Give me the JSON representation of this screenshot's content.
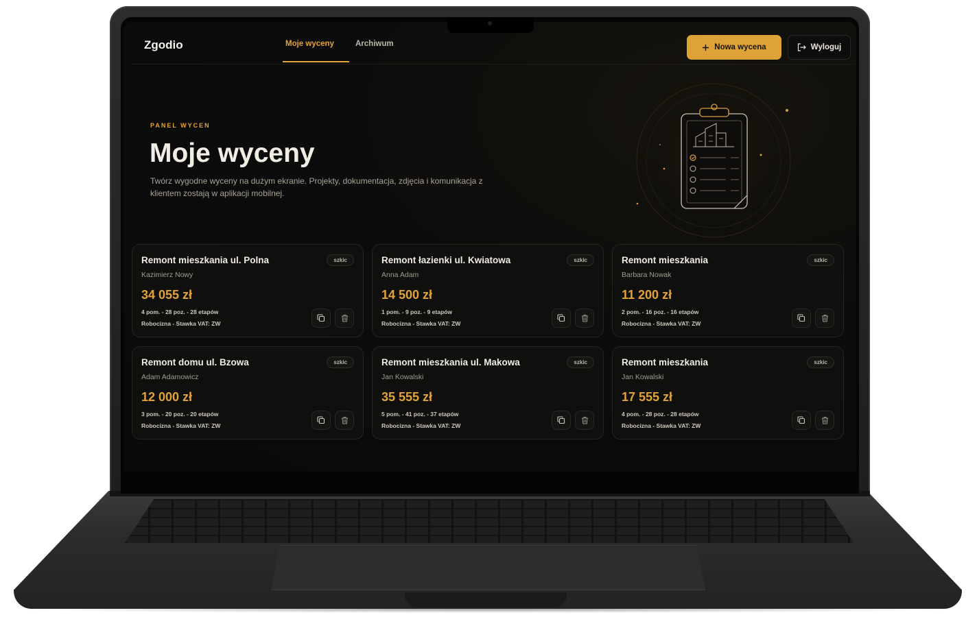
{
  "app": {
    "brand": "Zgodio"
  },
  "nav": {
    "tabs": [
      {
        "label": "Moje wyceny",
        "active": true
      },
      {
        "label": "Archiwum",
        "active": false
      }
    ],
    "new_quote_label": "Nowa wycena",
    "logout_label": "Wyloguj"
  },
  "hero": {
    "eyebrow": "PANEL WYCEN",
    "title": "Moje wyceny",
    "description": "Twórz wygodne wyceny na dużym ekranie. Projekty, dokumentacja, zdjęcia i komunikacja z klientem zostają w aplikacji mobilnej."
  },
  "quotes": [
    {
      "title": "Remont mieszkania ul. Polna",
      "client": "Kazimierz Nowy",
      "price": "34 055 zł",
      "meta": "4 pom. - 28 poz. - 28 etapów",
      "vat": "Robocizna - Stawka VAT: ZW",
      "status": "szkic"
    },
    {
      "title": "Remont łazienki ul. Kwiatowa",
      "client": "Anna Adam",
      "price": "14 500 zł",
      "meta": "1 pom. - 9 poz. - 9 etapów",
      "vat": "Robocizna - Stawka VAT: ZW",
      "status": "szkic"
    },
    {
      "title": "Remont mieszkania",
      "client": "Barbara Nowak",
      "price": "11 200 zł",
      "meta": "2 pom. - 16 poz. - 16 etapów",
      "vat": "Robocizna - Stawka VAT: ZW",
      "status": "szkic"
    },
    {
      "title": "Remont domu ul. Bzowa",
      "client": "Adam Adamowicz",
      "price": "12 000 zł",
      "meta": "3 pom. - 20 poz. - 20 etapów",
      "vat": "Robocizna - Stawka VAT: ZW",
      "status": "szkic"
    },
    {
      "title": "Remont mieszkania ul. Makowa",
      "client": "Jan Kowalski",
      "price": "35 555 zł",
      "meta": "5 pom. - 41 poz. - 37 etapów",
      "vat": "Robocizna - Stawka VAT: ZW",
      "status": "szkic"
    },
    {
      "title": "Remont mieszkania",
      "client": "Jan Kowalski",
      "price": "17 555 zł",
      "meta": "4 pom. - 28 poz. - 28 etapów",
      "vat": "Robocizna - Stawka VAT: ZW",
      "status": "szkic"
    }
  ],
  "icons": {
    "new_quote": "plus-icon",
    "logout": "logout-icon",
    "copy": "copy-icon",
    "delete": "trash-icon",
    "hero": "clipboard-checklist-icon"
  },
  "colors": {
    "accent": "#e3a33b",
    "background": "#0a0a0a",
    "card": "#0f0f0e"
  }
}
